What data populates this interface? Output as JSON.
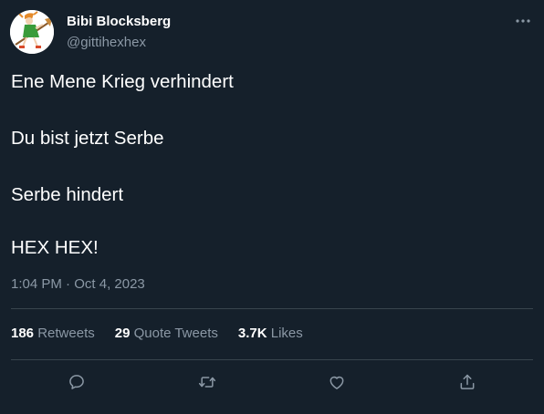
{
  "author": {
    "display_name": "Bibi Blocksberg",
    "handle": "@gittihexhex",
    "avatar_icon": "witch-on-broom-avatar"
  },
  "tweet": {
    "lines": [
      "Ene Mene Krieg verhindert",
      "Du bist jetzt Serbe",
      "Serbe hindert",
      "HEX HEX!"
    ],
    "time": "1:04 PM",
    "separator": " · ",
    "date": "Oct 4, 2023"
  },
  "stats": {
    "retweets": {
      "count": "186",
      "label": "Retweets"
    },
    "quote_tweets": {
      "count": "29",
      "label": "Quote Tweets"
    },
    "likes": {
      "count": "3.7K",
      "label": "Likes"
    }
  },
  "actions": {
    "reply_icon": "reply-icon",
    "retweet_icon": "retweet-icon",
    "like_icon": "heart-icon",
    "share_icon": "share-icon",
    "more_icon": "more-icon"
  },
  "colors": {
    "background": "#15202b",
    "text_primary": "#ffffff",
    "text_secondary": "#8b98a5",
    "divider": "#38444d"
  }
}
